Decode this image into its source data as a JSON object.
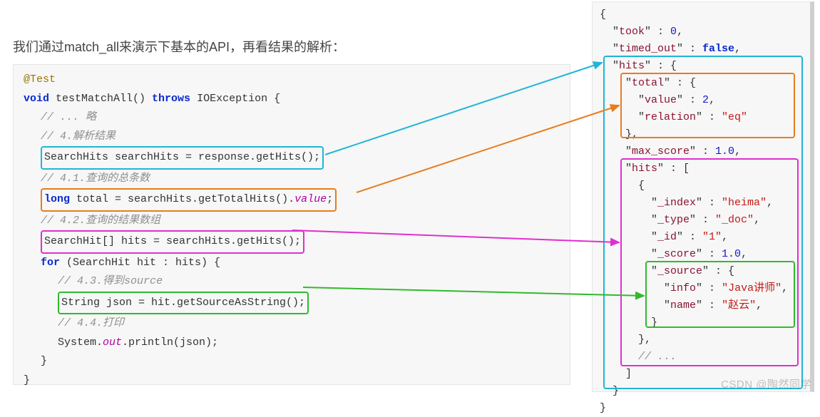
{
  "intro": "我们通过match_all来演示下基本的API，再看结果的解析：",
  "left": {
    "ann": "@Test",
    "kw_void": "void",
    "sig_name": " testMatchAll() ",
    "kw_throws": "throws",
    "sig_exc": " IOException {",
    "cmt_skip": "// ... 略",
    "cmt_4": "// 4.解析结果",
    "hl_cyan": "SearchHits searchHits = response.getHits();",
    "cmt_41": "// 4.1.查询的总条数",
    "hl_orange_kw": "long",
    "hl_orange_mid": " total = searchHits.getTotalHits().",
    "hl_orange_fld": "value",
    "hl_orange_end": ";",
    "cmt_42": "// 4.2.查询的结果数组",
    "hl_magenta": "SearchHit[] hits = searchHits.getHits();",
    "for_kw": "for",
    "for_rest": " (SearchHit hit : hits) {",
    "cmt_43": "// 4.3.得到source",
    "hl_green": "String json = hit.getSourceAsString();",
    "cmt_44": "// 4.4.打印",
    "print_a": "System.",
    "print_out": "out",
    "print_b": ".println(json);",
    "brace_inner": "}",
    "brace_outer": "}"
  },
  "right": {
    "open": "{",
    "l1a": "  \"",
    "k_took": "took",
    "l1b": "\" : ",
    "v_took": "0",
    "l1c": ",",
    "l2a": "  \"",
    "k_timed": "timed_out",
    "l2b": "\" : ",
    "v_timed": "false",
    "l2c": ",",
    "l3a": "  \"",
    "k_hits": "hits",
    "l3b": "\" : {",
    "l4a": "    \"",
    "k_total": "total",
    "l4b": "\" : {",
    "l5a": "      \"",
    "k_value": "value",
    "l5b": "\" : ",
    "v_value": "2",
    "l5c": ",",
    "l6a": "      \"",
    "k_relation": "relation",
    "l6b": "\" : ",
    "v_relation": "\"eq\"",
    "l7": "    },",
    "l8a": "    \"",
    "k_max": "max_score",
    "l8b": "\" : ",
    "v_max": "1.0",
    "l8c": ",",
    "l9a": "    \"",
    "k_hits2": "hits",
    "l9b": "\" : [",
    "l10": "      {",
    "l11a": "        \"",
    "k_index": "_index",
    "l11b": "\" : ",
    "v_index": "\"heima\"",
    "l11c": ",",
    "l12a": "        \"",
    "k_type": "_type",
    "l12b": "\" : ",
    "v_type": "\"_doc\"",
    "l12c": ",",
    "l13a": "        \"",
    "k_id": "_id",
    "l13b": "\" : ",
    "v_id": "\"1\"",
    "l13c": ",",
    "l14a": "        \"",
    "k_score": "_score",
    "l14b": "\" : ",
    "v_score": "1.0",
    "l14c": ",",
    "l15a": "        \"",
    "k_source": "_source",
    "l15b": "\" : {",
    "l16a": "          \"",
    "k_info": "info",
    "l16b": "\" : ",
    "v_info": "\"Java讲师\"",
    "l16c": ",",
    "l17a": "          \"",
    "k_name": "name",
    "l17b": "\" : ",
    "v_name": "\"赵云\"",
    "l17c": ",",
    "l18": "        }",
    "l19": "      },",
    "l20": "      // ...",
    "l21": "    ]",
    "l22": "  }",
    "close": "}"
  },
  "watermark": "CSDN @陶然同学"
}
